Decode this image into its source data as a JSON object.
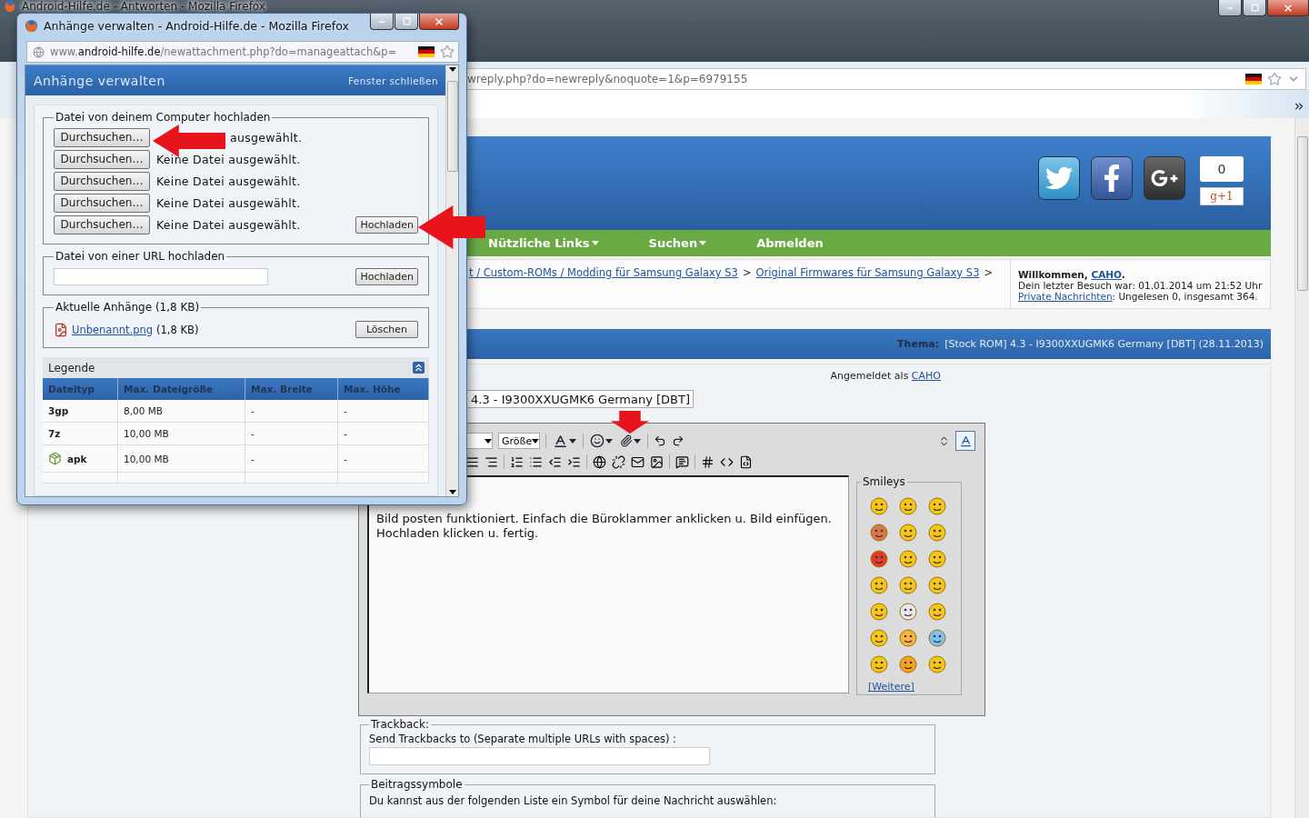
{
  "main_window": {
    "title": "Android-Hilfe.de - Antworten - Mozilla Firefox",
    "url": "wreply.php?do=newreply&noquote=1&p=6979155"
  },
  "header": {
    "plus_count": "0",
    "plus_label": "g+1"
  },
  "nav": [
    {
      "label": "Nützliche Links",
      "dropdown": true
    },
    {
      "label": "Suchen",
      "dropdown": true
    },
    {
      "label": "Abmelden",
      "dropdown": false
    }
  ],
  "breadcrumb": [
    {
      "label": "t / Custom-ROMs / Modding für Samsung Galaxy S3",
      "separator": ">"
    },
    {
      "label": "Original Firmwares für Samsung Galaxy S3",
      "separator": ">"
    }
  ],
  "welcome": {
    "greeting": "Willkommen,",
    "user": "CAHO",
    "end": ".",
    "last_visit": "Dein letzter Besuch war: 01.01.2014 um 21:52 Uhr",
    "pm_link": "Private Nachrichten",
    "pm_text": ": Ungelesen 0, insgesamt 364."
  },
  "thread_bar": {
    "label": "Thema:",
    "title": "[Stock ROM] 4.3 - I9300XXUGMK6 Germany [DBT] (28.11.2013)"
  },
  "logged_in": {
    "label": "Angemeldet als",
    "user": "CAHO"
  },
  "subject": {
    "value": "4.3 - I9300XXUGMK6 Germany [DBT]"
  },
  "editor": {
    "size_select": "Größe",
    "message": [
      "Bild posten funktioniert. Einfach die Büroklammer anklicken u. Bild einfügen.",
      "Hochladen klicken u. fertig."
    ],
    "smileys_legend": "Smileys",
    "more_link": "[Weitere]"
  },
  "trackback": {
    "legend": "Trackback:",
    "label": "Send Trackbacks to (Separate multiple URLs with spaces) :"
  },
  "post_icons": {
    "legend": "Beitragssymbole",
    "text": "Du kannst aus der folgenden Liste ein Symbol für deine Nachricht auswählen:"
  },
  "popup": {
    "title": "Anhänge verwalten - Android-Hilfe.de - Mozilla Firefox",
    "url": "www.**android-hilfe.de**/newattachment.php?do=manageattach&p=",
    "heading": "Anhänge verwalten",
    "close_link": "Fenster schließen",
    "computer_upload": {
      "legend": "Datei von deinem Computer hochladen",
      "files": [
        {
          "button": "Durchsuchen…",
          "status": "ausgewählt.",
          "covered": true
        },
        {
          "button": "Durchsuchen…",
          "status": "Keine Datei ausgewählt.",
          "covered": false
        },
        {
          "button": "Durchsuchen…",
          "status": "Keine Datei ausgewählt.",
          "covered": false
        },
        {
          "button": "Durchsuchen…",
          "status": "Keine Datei ausgewählt.",
          "covered": false
        },
        {
          "button": "Durchsuchen…",
          "status": "Keine Datei ausgewählt.",
          "covered": false
        }
      ],
      "upload_button": "Hochladen"
    },
    "url_upload": {
      "legend": "Datei von einer URL hochladen",
      "upload_button": "Hochladen"
    },
    "attachments": {
      "legend": "Aktuelle Anhänge (1,8 KB)",
      "items": [
        {
          "name": "Unbenannt.png",
          "size": "(1,8 KB)",
          "delete_button": "Löschen"
        }
      ]
    },
    "legend_table": {
      "title": "Legende",
      "columns": [
        "Dateityp",
        "Max. Dateigröße",
        "Max. Breite",
        "Max. Höhe"
      ],
      "rows": [
        {
          "kind": "plain",
          "cells": [
            "3gp",
            "8,00 MB",
            "-",
            "-"
          ]
        },
        {
          "kind": "plain",
          "cells": [
            "7z",
            "10,00 MB",
            "-",
            "-"
          ]
        },
        {
          "kind": "icon",
          "cells": [
            "apk",
            "10,00 MB",
            "-",
            "-"
          ]
        }
      ]
    }
  }
}
